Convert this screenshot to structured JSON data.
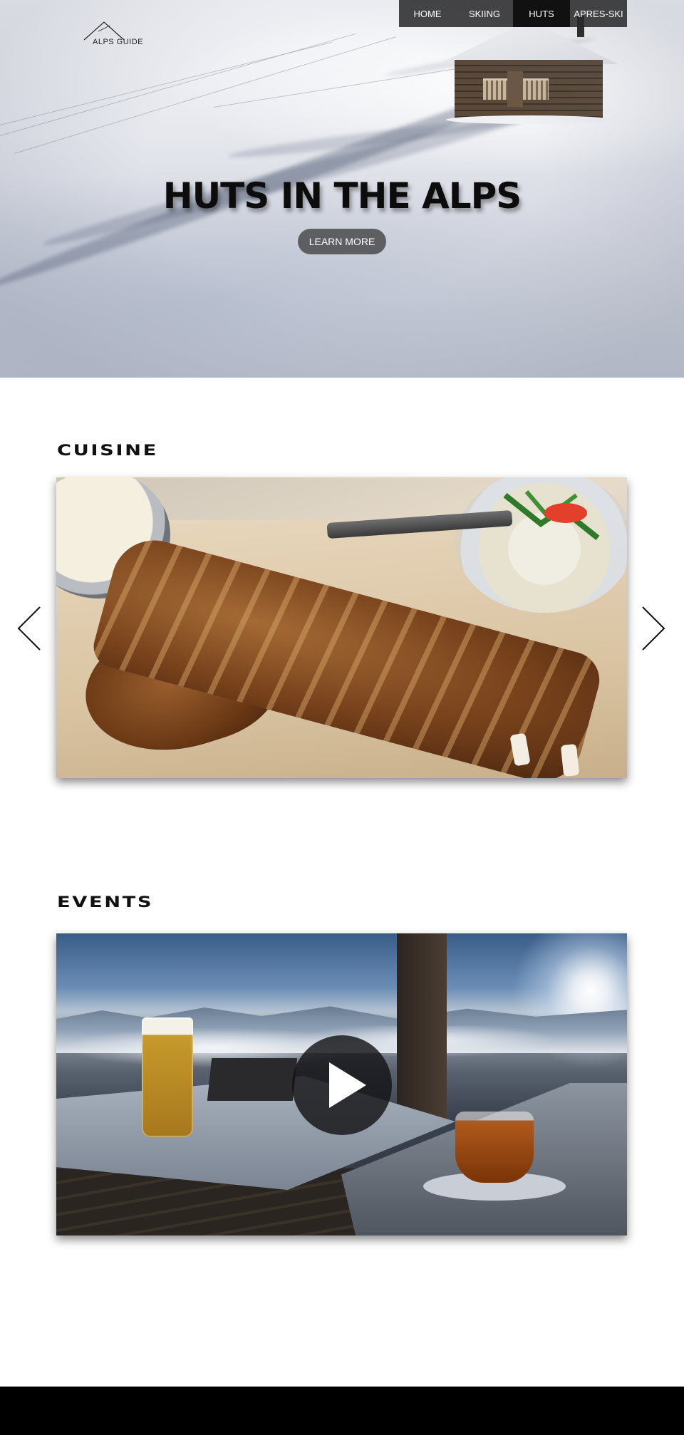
{
  "brand": {
    "logo_text": "ALPS GUIDE"
  },
  "nav": {
    "items": [
      {
        "label": "HOME",
        "active": false
      },
      {
        "label": "SKIING",
        "active": false
      },
      {
        "label": "HUTS",
        "active": true
      },
      {
        "label": "APRES-SKI",
        "active": false
      }
    ]
  },
  "hero": {
    "title": "HUTS IN THE ALPS",
    "button_label": "LEARN MORE"
  },
  "cuisine": {
    "heading": "CUISINE"
  },
  "events": {
    "heading": "EVENTS"
  },
  "colors": {
    "nav_bg": "#2b2b2d",
    "nav_active": "#111111",
    "button_bg": "#4a4a4c",
    "footer": "#000000"
  },
  "icons": {
    "carousel_prev": "chevron-left-icon",
    "carousel_next": "chevron-right-icon",
    "video_play": "play-icon",
    "logo": "mountain-icon"
  }
}
